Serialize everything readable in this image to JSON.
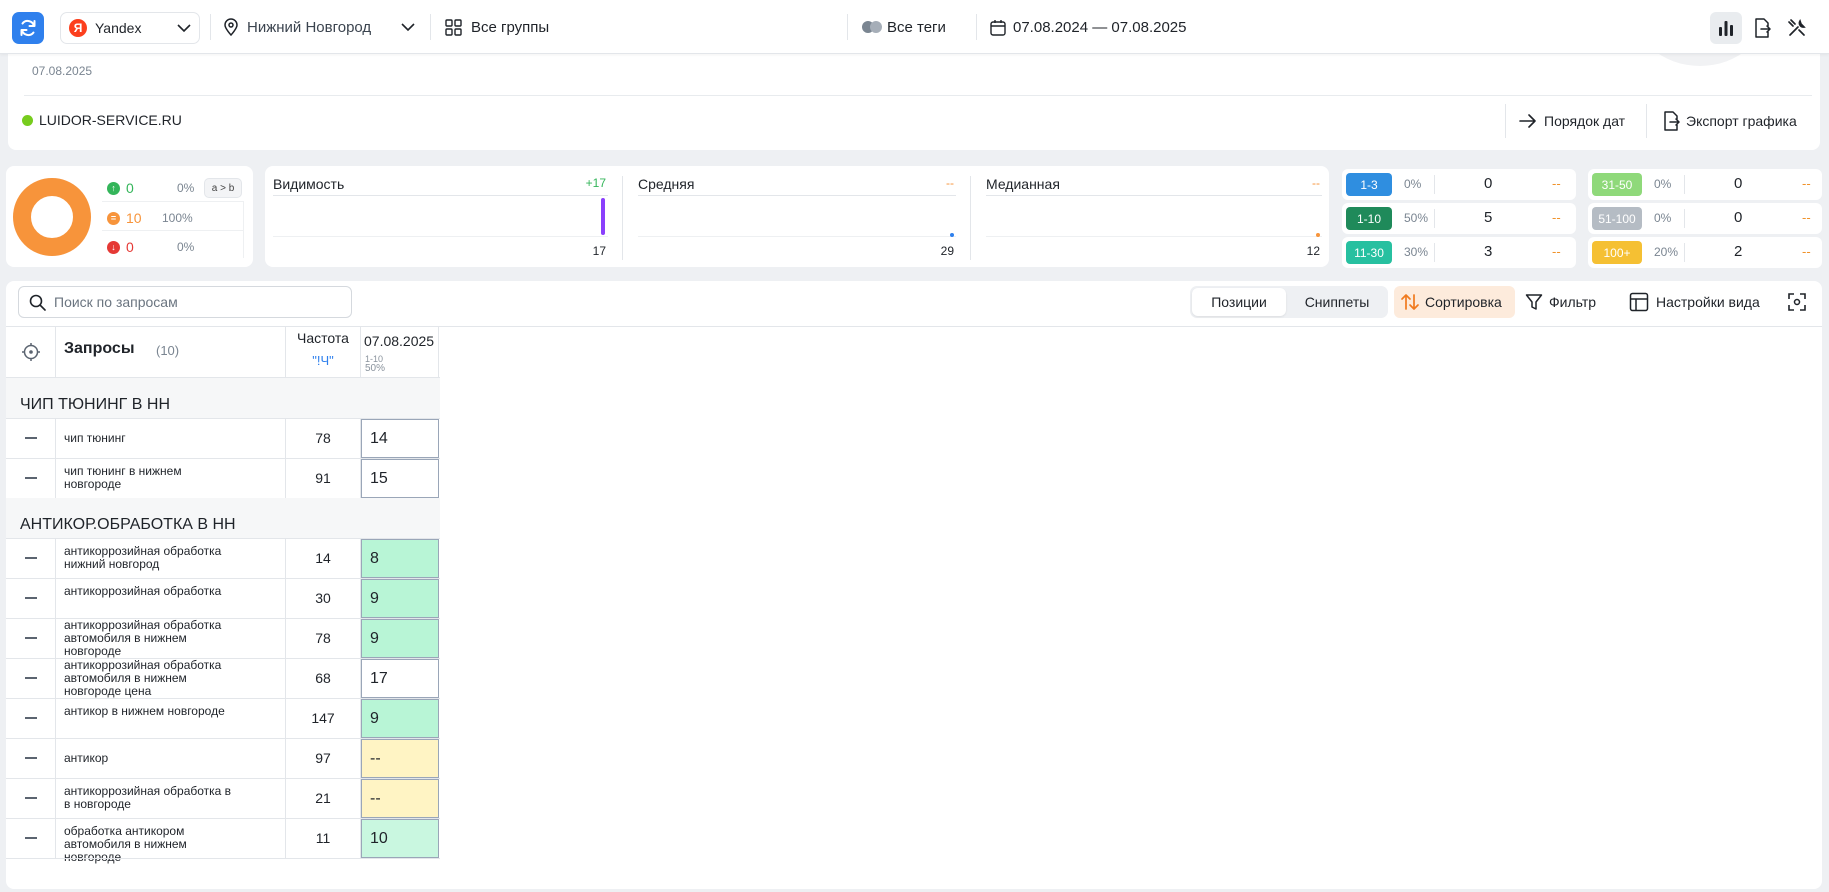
{
  "topbar": {
    "engine": "Yandex",
    "engine_logo": "Я",
    "region": "Нижний Новгород",
    "groups": "Все группы",
    "tags": "Все теги",
    "date_range": "07.08.2024 — 07.08.2025"
  },
  "header": {
    "date_label": "07.08.2025",
    "site": "LUIDOR-SERVICE.RU",
    "date_order_button": "Порядок дат",
    "export_button": "Экспорт графика"
  },
  "summary": {
    "up": {
      "count": "0",
      "pct": "0%"
    },
    "same": {
      "count": "10",
      "pct": "100%"
    },
    "down": {
      "count": "0",
      "pct": "0%"
    },
    "compare_button": "a > b"
  },
  "metrics": {
    "visibility": {
      "title": "Видимость",
      "delta": "+17",
      "value": "17"
    },
    "average": {
      "title": "Средняя",
      "delta": "--",
      "value": "29"
    },
    "median": {
      "title": "Медианная",
      "delta": "--",
      "value": "12"
    }
  },
  "ranges": [
    {
      "label": "1-3",
      "pct": "0%",
      "count": "0",
      "delta": "--",
      "color": "#2f8ee0"
    },
    {
      "label": "1-10",
      "pct": "50%",
      "count": "5",
      "delta": "--",
      "color": "#1f8a5a"
    },
    {
      "label": "11-30",
      "pct": "30%",
      "count": "3",
      "delta": "--",
      "color": "#27c0a0"
    },
    {
      "label": "31-50",
      "pct": "0%",
      "count": "0",
      "delta": "--",
      "color": "#8fd97a"
    },
    {
      "label": "51-100",
      "pct": "0%",
      "count": "0",
      "delta": "--",
      "color": "#b5bcc4"
    },
    {
      "label": "100+",
      "pct": "20%",
      "count": "2",
      "delta": "--",
      "color": "#f5c033"
    }
  ],
  "toolbar": {
    "search_placeholder": "Поиск по запросам",
    "tab_positions": "Позиции",
    "tab_snippets": "Сниппеты",
    "sort": "Сортировка",
    "filter": "Фильтр",
    "view_settings": "Настройки вида"
  },
  "table": {
    "title": "Запросы",
    "count": "(10)",
    "freq_header": "Частота",
    "freq_sub": "\"!Ч\"",
    "date_header": "07.08.2025",
    "date_sub1": "1-10",
    "date_sub2": "50%",
    "groups": [
      {
        "title": "ЧИП ТЮНИНГ В НН",
        "rows": [
          {
            "query": "чип тюнинг",
            "freq": "78",
            "pos": "14",
            "bg": "#ffffff"
          },
          {
            "query": "чип тюнинг в нижнем новгороде",
            "freq": "91",
            "pos": "15",
            "bg": "#ffffff"
          }
        ]
      },
      {
        "title": "АНТИКОР.ОБРАБОТКА В НН",
        "rows": [
          {
            "query": "антикоррозийная обработка нижний новгород",
            "freq": "14",
            "pos": "8",
            "bg": "#b8f5d6"
          },
          {
            "query": "антикоррозийная обработка",
            "freq": "30",
            "pos": "9",
            "bg": "#b8f5d6"
          },
          {
            "query": "антикоррозийная обработка автомобиля в нижнем новгороде",
            "freq": "78",
            "pos": "9",
            "bg": "#b8f5d6"
          },
          {
            "query": "антикоррозийная обработка автомобиля в нижнем новгороде цена",
            "freq": "68",
            "pos": "17",
            "bg": "#ffffff"
          },
          {
            "query": "антикор в нижнем новгороде",
            "freq": "147",
            "pos": "9",
            "bg": "#b8f5d6"
          },
          {
            "query": "антикор",
            "freq": "97",
            "pos": "--",
            "bg": "#fff4c4"
          },
          {
            "query": "антикоррозийная обработка в в новгороде",
            "freq": "21",
            "pos": "--",
            "bg": "#fff4c4"
          },
          {
            "query": "обработка антикором автомобиля в нижнем новгороде",
            "freq": "11",
            "pos": "10",
            "bg": "#c9f7e0"
          }
        ]
      }
    ]
  }
}
